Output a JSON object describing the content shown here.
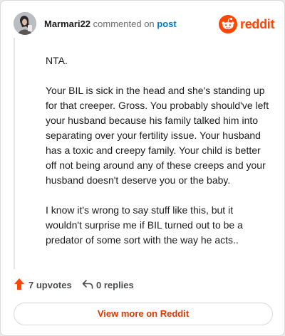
{
  "header": {
    "username": "Marmari22",
    "action_text": "commented on",
    "post_link": "post",
    "avatar": "user-avatar",
    "brand_name": "reddit",
    "brand_color": "#ff4500"
  },
  "comment": {
    "paragraphs": [
      "NTA.",
      "Your BIL is sick in the head and she's standing up for that creeper. Gross. You probably should've left your husband because his family talked him into separating over your fertility issue. Your husband has a toxic and creepy family. Your child is better off not being around any of these creeps and your husband doesn't deserve you or the baby.",
      "I know it's wrong to say stuff like this, but it wouldn't surprise me if BIL turned out to be a predator of some sort with the way he acts.."
    ]
  },
  "footer": {
    "upvotes_label": "7 upvotes",
    "replies_label": "0 replies",
    "upvote_icon": "upvote-arrow-icon",
    "reply_icon": "reply-arrow-icon",
    "upvote_color": "#ff4500"
  },
  "cta": {
    "label": "View more on Reddit",
    "color": "#d93a00"
  }
}
